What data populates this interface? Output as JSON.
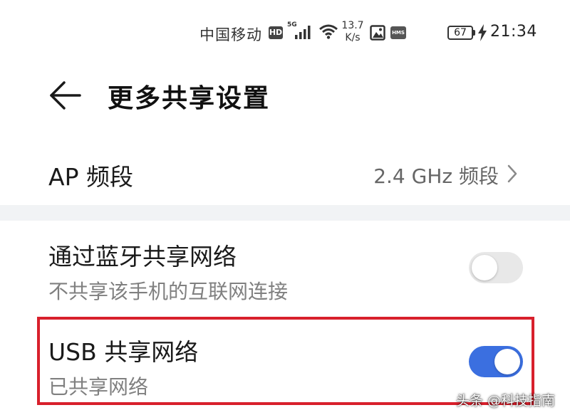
{
  "status_bar": {
    "carrier": "中国移动",
    "hd_badge": "HD",
    "network_type": "5G",
    "speed_value": "13.7",
    "speed_unit": "K/s",
    "hms_badge": "HMS",
    "battery_level": "67",
    "time": "21:34",
    "icons": [
      "signal-bars-icon",
      "wifi-icon",
      "photo-icon",
      "charging-bolt-icon"
    ]
  },
  "header": {
    "title": "更多共享设置",
    "back_icon": "arrow-left-icon"
  },
  "ap_band": {
    "label": "AP 频段",
    "value": "2.4 GHz 频段",
    "icon": "chevron-right-icon"
  },
  "bluetooth_tether": {
    "title": "通过蓝牙共享网络",
    "subtitle": "不共享该手机的互联网连接",
    "enabled": false
  },
  "usb_tether": {
    "title": "USB 共享网络",
    "subtitle": "已共享网络",
    "enabled": true
  },
  "colors": {
    "accent": "#3b6fe0",
    "switch_off": "#e8e8e8",
    "highlight": "#d8202c",
    "section_gap": "#f1f3f5"
  },
  "watermark": "头条 @科技指南"
}
